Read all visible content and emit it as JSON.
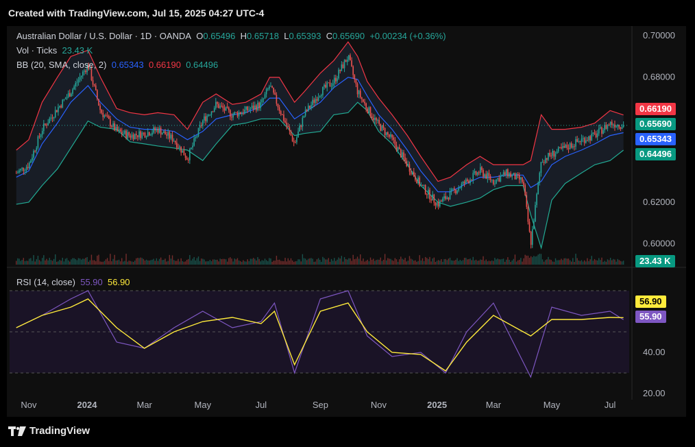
{
  "header": {
    "text": "Created with TradingView.com, Jul 15, 2025 04:27 UTC-4"
  },
  "footer": {
    "brand": "TradingView"
  },
  "legend": {
    "symbol": "Australian Dollar / U.S. Dollar · 1D · OANDA",
    "open_label": "O",
    "open": "0.65496",
    "high_label": "H",
    "high": "0.65718",
    "low_label": "L",
    "low": "0.65393",
    "close_label": "C",
    "close": "0.65690",
    "change": "+0.00234 (+0.36%)",
    "vol_label": "Vol · Ticks",
    "vol": "23.43 K",
    "bb_label": "BB (20, SMA, close, 2)",
    "bb_basis": "0.65343",
    "bb_upper": "0.66190",
    "bb_lower": "0.64496",
    "rsi_label": "RSI (14, close)",
    "rsi": "55.90",
    "rsi_ma": "56.90"
  },
  "badges": {
    "bb_upper": "0.66190",
    "close": "0.65690",
    "bb_basis": "0.65343",
    "bb_lower": "0.64496",
    "volume": "23.43 K",
    "rsi_ma": "56.90",
    "rsi": "55.90"
  },
  "colors": {
    "up": "#26a69a",
    "down": "#ef5350",
    "bb_basis": "#2962ff",
    "bb_upper": "#f23645",
    "bb_lower": "#22ab94",
    "rsi": "#7e57c2",
    "rsi_ma": "#ffeb3b",
    "grid": "#1e1e1e"
  },
  "chart_data": [
    {
      "type": "candlestick",
      "title": "Australian Dollar / U.S. Dollar · 1D · OANDA",
      "x_ticks": [
        "Nov",
        "2024",
        "Mar",
        "May",
        "Jul",
        "Sep",
        "Nov",
        "2025",
        "Mar",
        "May",
        "Jul"
      ],
      "y_ticks": [
        "0.70000",
        "0.68000",
        "0.62000",
        "0.60000"
      ],
      "ylim": [
        0.59,
        0.7
      ],
      "close_series": {
        "x": [
          "2023-10-19",
          "2023-11-01",
          "2023-11-15",
          "2023-12-01",
          "2023-12-15",
          "2024-01-02",
          "2024-01-15",
          "2024-02-01",
          "2024-02-15",
          "2024-03-01",
          "2024-03-15",
          "2024-04-01",
          "2024-04-15",
          "2024-05-01",
          "2024-05-15",
          "2024-06-01",
          "2024-06-15",
          "2024-07-01",
          "2024-07-10",
          "2024-07-20",
          "2024-08-05",
          "2024-08-15",
          "2024-09-01",
          "2024-09-15",
          "2024-09-30",
          "2024-10-10",
          "2024-10-20",
          "2024-11-01",
          "2024-11-15",
          "2024-12-01",
          "2024-12-15",
          "2025-01-02",
          "2025-01-15",
          "2025-02-01",
          "2025-02-15",
          "2025-03-01",
          "2025-03-15",
          "2025-04-01",
          "2025-04-09",
          "2025-04-20",
          "2025-05-01",
          "2025-05-15",
          "2025-06-01",
          "2025-06-15",
          "2025-07-01",
          "2025-07-15"
        ],
        "close": [
          0.634,
          0.638,
          0.655,
          0.665,
          0.673,
          0.686,
          0.664,
          0.654,
          0.652,
          0.653,
          0.655,
          0.65,
          0.641,
          0.659,
          0.667,
          0.662,
          0.664,
          0.667,
          0.676,
          0.665,
          0.648,
          0.662,
          0.673,
          0.678,
          0.69,
          0.673,
          0.665,
          0.657,
          0.65,
          0.638,
          0.628,
          0.619,
          0.624,
          0.63,
          0.635,
          0.63,
          0.634,
          0.63,
          0.6,
          0.64,
          0.643,
          0.646,
          0.65,
          0.652,
          0.658,
          0.6569
        ]
      },
      "bb_upper": [
        0.645,
        0.65,
        0.668,
        0.68,
        0.69,
        0.693,
        0.68,
        0.665,
        0.663,
        0.662,
        0.663,
        0.662,
        0.655,
        0.668,
        0.672,
        0.667,
        0.668,
        0.672,
        0.68,
        0.68,
        0.668,
        0.673,
        0.682,
        0.688,
        0.697,
        0.69,
        0.678,
        0.67,
        0.662,
        0.652,
        0.642,
        0.63,
        0.632,
        0.638,
        0.642,
        0.638,
        0.638,
        0.638,
        0.64,
        0.662,
        0.655,
        0.655,
        0.656,
        0.658,
        0.664,
        0.6619
      ],
      "bb_basis": [
        0.632,
        0.635,
        0.648,
        0.658,
        0.668,
        0.676,
        0.668,
        0.66,
        0.656,
        0.655,
        0.655,
        0.654,
        0.65,
        0.654,
        0.66,
        0.662,
        0.663,
        0.666,
        0.67,
        0.67,
        0.66,
        0.663,
        0.668,
        0.675,
        0.68,
        0.679,
        0.671,
        0.662,
        0.655,
        0.645,
        0.635,
        0.625,
        0.625,
        0.629,
        0.632,
        0.632,
        0.633,
        0.633,
        0.627,
        0.63,
        0.638,
        0.642,
        0.645,
        0.648,
        0.652,
        0.6534
      ],
      "bb_lower": [
        0.619,
        0.62,
        0.628,
        0.636,
        0.646,
        0.659,
        0.656,
        0.655,
        0.649,
        0.648,
        0.647,
        0.646,
        0.645,
        0.64,
        0.648,
        0.657,
        0.658,
        0.66,
        0.66,
        0.66,
        0.652,
        0.653,
        0.654,
        0.662,
        0.663,
        0.668,
        0.664,
        0.654,
        0.648,
        0.638,
        0.628,
        0.62,
        0.618,
        0.62,
        0.622,
        0.626,
        0.628,
        0.628,
        0.614,
        0.598,
        0.621,
        0.629,
        0.634,
        0.638,
        0.64,
        0.645
      ]
    },
    {
      "type": "bar",
      "title": "Vol · Ticks",
      "last_value": "23.43 K"
    },
    {
      "type": "line",
      "title": "RSI (14, close)",
      "y_ticks": [
        "40.00",
        "20.00"
      ],
      "ylim": [
        20,
        80
      ],
      "reference_levels": [
        70,
        50,
        30
      ],
      "x": [
        "2023-10-19",
        "2023-11-15",
        "2023-12-15",
        "2024-01-02",
        "2024-02-01",
        "2024-03-01",
        "2024-04-01",
        "2024-05-01",
        "2024-06-01",
        "2024-07-01",
        "2024-07-15",
        "2024-08-05",
        "2024-09-01",
        "2024-09-30",
        "2024-10-20",
        "2024-11-15",
        "2024-12-15",
        "2025-01-10",
        "2025-02-01",
        "2025-03-01",
        "2025-04-09",
        "2025-05-01",
        "2025-06-01",
        "2025-07-01",
        "2025-07-15"
      ],
      "rsi": [
        52,
        58,
        66,
        70,
        45,
        42,
        52,
        60,
        52,
        55,
        64,
        30,
        66,
        70,
        48,
        38,
        40,
        30,
        50,
        64,
        28,
        62,
        58,
        60,
        55.9
      ],
      "rsi_ma": [
        52,
        58,
        62,
        66,
        52,
        42,
        50,
        55,
        57,
        54,
        60,
        34,
        60,
        64,
        50,
        40,
        39,
        31,
        45,
        58,
        48,
        56,
        56,
        57,
        56.9
      ]
    }
  ]
}
